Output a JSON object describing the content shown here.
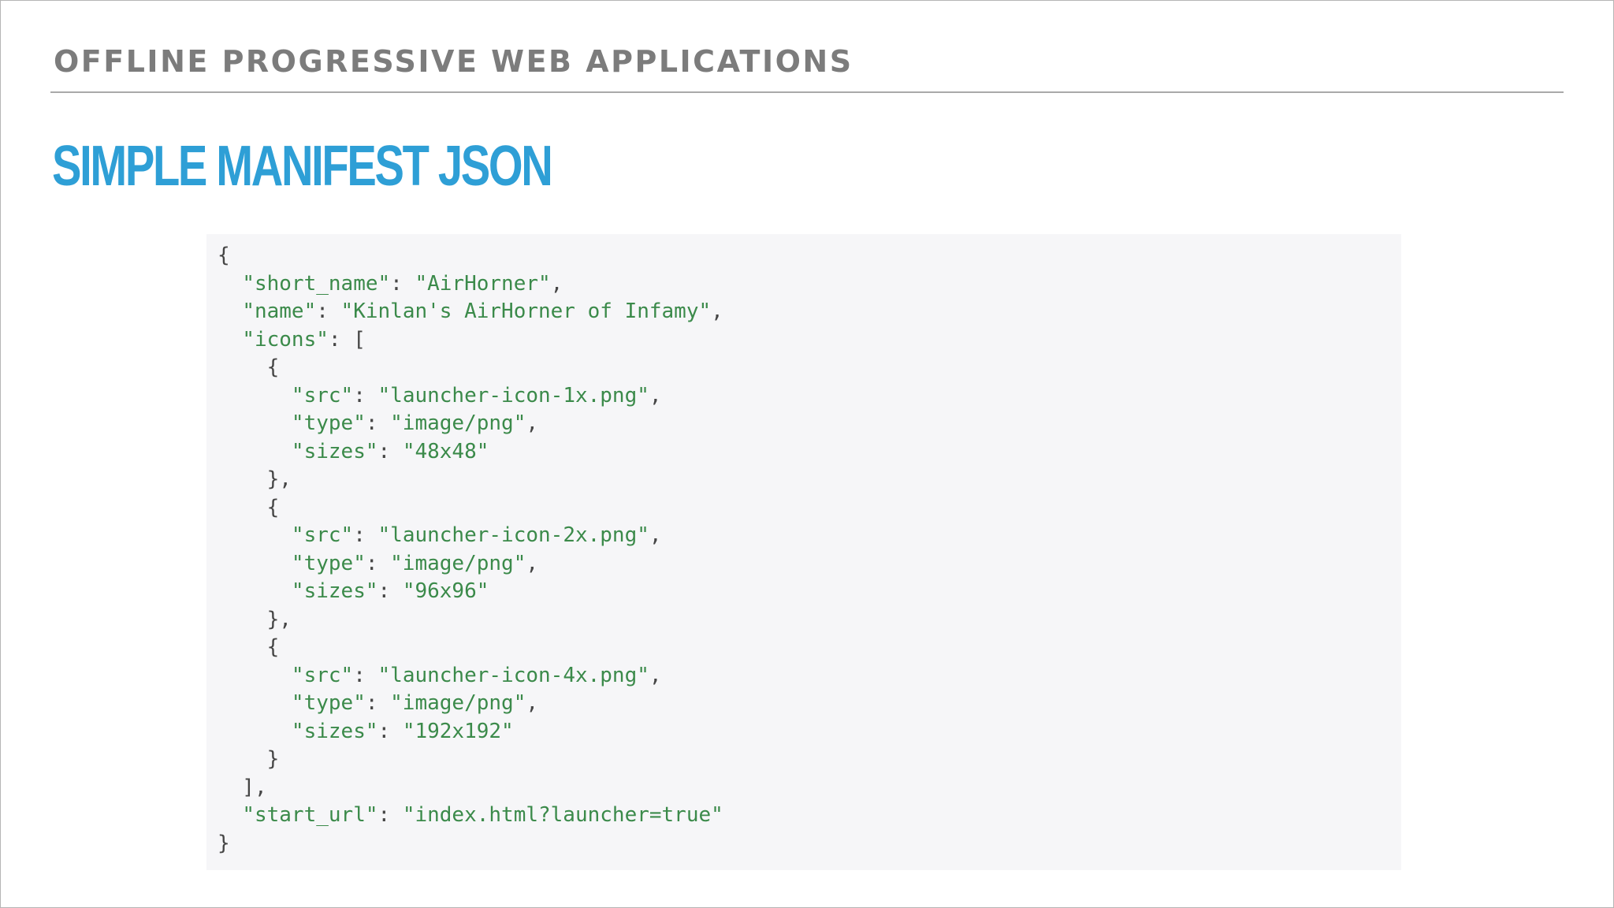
{
  "slide": {
    "section_title": "OFFLINE PROGRESSIVE WEB APPLICATIONS",
    "title": "SIMPLE MANIFEST JSON"
  },
  "colors": {
    "section_title": "#7c7c7c",
    "title": "#2e9fd6",
    "code_string": "#3b8a4a",
    "code_punct": "#454545",
    "code_background": "#f6f6f8"
  },
  "code_lines": [
    [
      {
        "t": "{",
        "c": "p"
      }
    ],
    [
      {
        "t": "  ",
        "c": "p"
      },
      {
        "t": "\"short_name\"",
        "c": "s"
      },
      {
        "t": ": ",
        "c": "p"
      },
      {
        "t": "\"AirHorner\"",
        "c": "s"
      },
      {
        "t": ",",
        "c": "p"
      }
    ],
    [
      {
        "t": "  ",
        "c": "p"
      },
      {
        "t": "\"name\"",
        "c": "s"
      },
      {
        "t": ": ",
        "c": "p"
      },
      {
        "t": "\"Kinlan's AirHorner of Infamy\"",
        "c": "s"
      },
      {
        "t": ",",
        "c": "p"
      }
    ],
    [
      {
        "t": "  ",
        "c": "p"
      },
      {
        "t": "\"icons\"",
        "c": "s"
      },
      {
        "t": ": [",
        "c": "p"
      }
    ],
    [
      {
        "t": "    {",
        "c": "p"
      }
    ],
    [
      {
        "t": "      ",
        "c": "p"
      },
      {
        "t": "\"src\"",
        "c": "s"
      },
      {
        "t": ": ",
        "c": "p"
      },
      {
        "t": "\"launcher-icon-1x.png\"",
        "c": "s"
      },
      {
        "t": ",",
        "c": "p"
      }
    ],
    [
      {
        "t": "      ",
        "c": "p"
      },
      {
        "t": "\"type\"",
        "c": "s"
      },
      {
        "t": ": ",
        "c": "p"
      },
      {
        "t": "\"image/png\"",
        "c": "s"
      },
      {
        "t": ",",
        "c": "p"
      }
    ],
    [
      {
        "t": "      ",
        "c": "p"
      },
      {
        "t": "\"sizes\"",
        "c": "s"
      },
      {
        "t": ": ",
        "c": "p"
      },
      {
        "t": "\"48x48\"",
        "c": "s"
      }
    ],
    [
      {
        "t": "    },",
        "c": "p"
      }
    ],
    [
      {
        "t": "    {",
        "c": "p"
      }
    ],
    [
      {
        "t": "      ",
        "c": "p"
      },
      {
        "t": "\"src\"",
        "c": "s"
      },
      {
        "t": ": ",
        "c": "p"
      },
      {
        "t": "\"launcher-icon-2x.png\"",
        "c": "s"
      },
      {
        "t": ",",
        "c": "p"
      }
    ],
    [
      {
        "t": "      ",
        "c": "p"
      },
      {
        "t": "\"type\"",
        "c": "s"
      },
      {
        "t": ": ",
        "c": "p"
      },
      {
        "t": "\"image/png\"",
        "c": "s"
      },
      {
        "t": ",",
        "c": "p"
      }
    ],
    [
      {
        "t": "      ",
        "c": "p"
      },
      {
        "t": "\"sizes\"",
        "c": "s"
      },
      {
        "t": ": ",
        "c": "p"
      },
      {
        "t": "\"96x96\"",
        "c": "s"
      }
    ],
    [
      {
        "t": "    },",
        "c": "p"
      }
    ],
    [
      {
        "t": "    {",
        "c": "p"
      }
    ],
    [
      {
        "t": "      ",
        "c": "p"
      },
      {
        "t": "\"src\"",
        "c": "s"
      },
      {
        "t": ": ",
        "c": "p"
      },
      {
        "t": "\"launcher-icon-4x.png\"",
        "c": "s"
      },
      {
        "t": ",",
        "c": "p"
      }
    ],
    [
      {
        "t": "      ",
        "c": "p"
      },
      {
        "t": "\"type\"",
        "c": "s"
      },
      {
        "t": ": ",
        "c": "p"
      },
      {
        "t": "\"image/png\"",
        "c": "s"
      },
      {
        "t": ",",
        "c": "p"
      }
    ],
    [
      {
        "t": "      ",
        "c": "p"
      },
      {
        "t": "\"sizes\"",
        "c": "s"
      },
      {
        "t": ": ",
        "c": "p"
      },
      {
        "t": "\"192x192\"",
        "c": "s"
      }
    ],
    [
      {
        "t": "    }",
        "c": "p"
      }
    ],
    [
      {
        "t": "  ],",
        "c": "p"
      }
    ],
    [
      {
        "t": "  ",
        "c": "p"
      },
      {
        "t": "\"start_url\"",
        "c": "s"
      },
      {
        "t": ": ",
        "c": "p"
      },
      {
        "t": "\"index.html?launcher=true\"",
        "c": "s"
      }
    ],
    [
      {
        "t": "}",
        "c": "p"
      }
    ]
  ]
}
